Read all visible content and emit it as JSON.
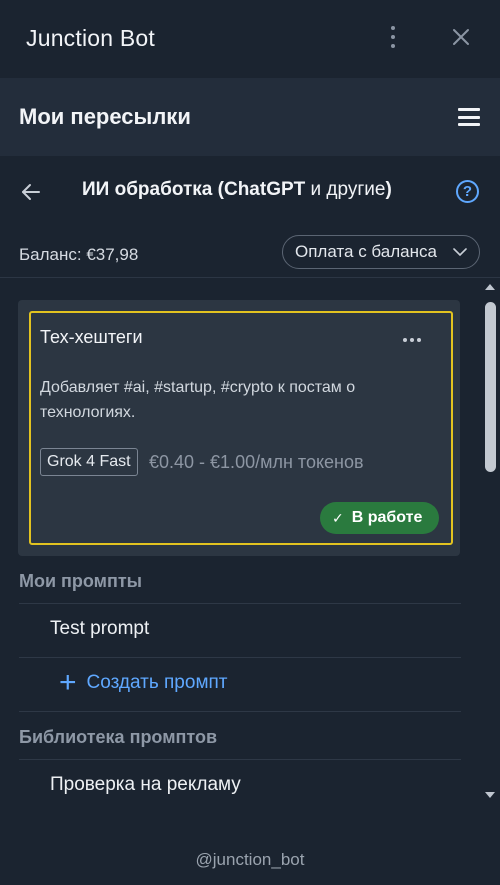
{
  "window": {
    "title": "Junction Bot"
  },
  "header": {
    "title": "Мои пересылки"
  },
  "subheader": {
    "title_prefix": "ИИ обработка (",
    "title_brand": "ChatGPT",
    "title_mid": " и другие",
    "title_suffix": ")",
    "help_label": "?"
  },
  "balance": {
    "label": "Баланс: €37,98",
    "payment_mode": "Оплата с баланса"
  },
  "active_card": {
    "title": "Тех-хештеги",
    "description": "Добавляет #ai, #startup, #crypto к постам о технологиях.",
    "model": "Grok 4 Fast",
    "price": "€0.40 - €1.00/млн токенов",
    "status": "В работе",
    "status_check": "✓"
  },
  "my_prompts": {
    "heading": "Мои промпты",
    "items": [
      "Test prompt"
    ],
    "create_label": "Создать промпт",
    "create_icon": "+"
  },
  "library": {
    "heading": "Библиотека промптов",
    "items": [
      "Проверка на рекламу"
    ]
  },
  "footer": {
    "handle": "@junction_bot"
  },
  "colors": {
    "background": "#1b2430",
    "header": "#232d3b",
    "accent": "#5fa8ff",
    "highlight_border": "#e2c320",
    "status_green": "#2a7a3e"
  }
}
